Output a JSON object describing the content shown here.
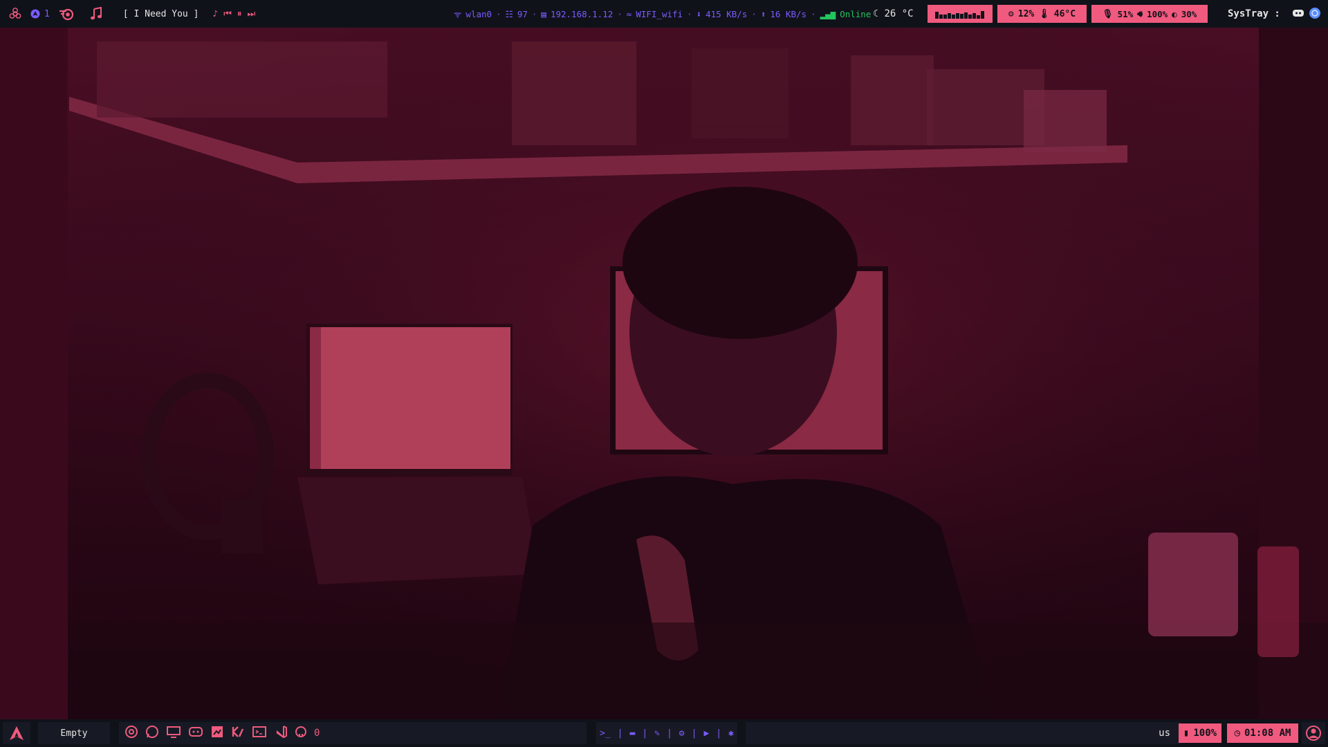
{
  "topbar": {
    "workspace_count": "1",
    "now_playing": "[ I Need You ]",
    "network": {
      "interface": "wlan0",
      "signal": "97",
      "ip": "192.168.1.12",
      "ssid": "WIFI_wifi",
      "download": "415 KB/s",
      "upload": "16 KB/s",
      "status": "Online"
    },
    "weather": "26 °C",
    "cpu": "12%",
    "cpu_temp": "46°C",
    "mic": "51%",
    "volume": "100%",
    "brightness": "30%",
    "systray_label": "SysTray :"
  },
  "bottombar": {
    "window_title": "Empty",
    "counter": "0",
    "keyboard_layout": "us",
    "battery": "100%",
    "clock": "01:08 AM"
  },
  "icons": {
    "arch_logo": "arch-icon",
    "biohazard": "biohazard-icon",
    "music": "music-note-icon"
  },
  "colors": {
    "accent_pink": "#f05a7e",
    "accent_purple": "#7b5cff",
    "status_green": "#22c55e",
    "bar_bg": "#10121a"
  }
}
